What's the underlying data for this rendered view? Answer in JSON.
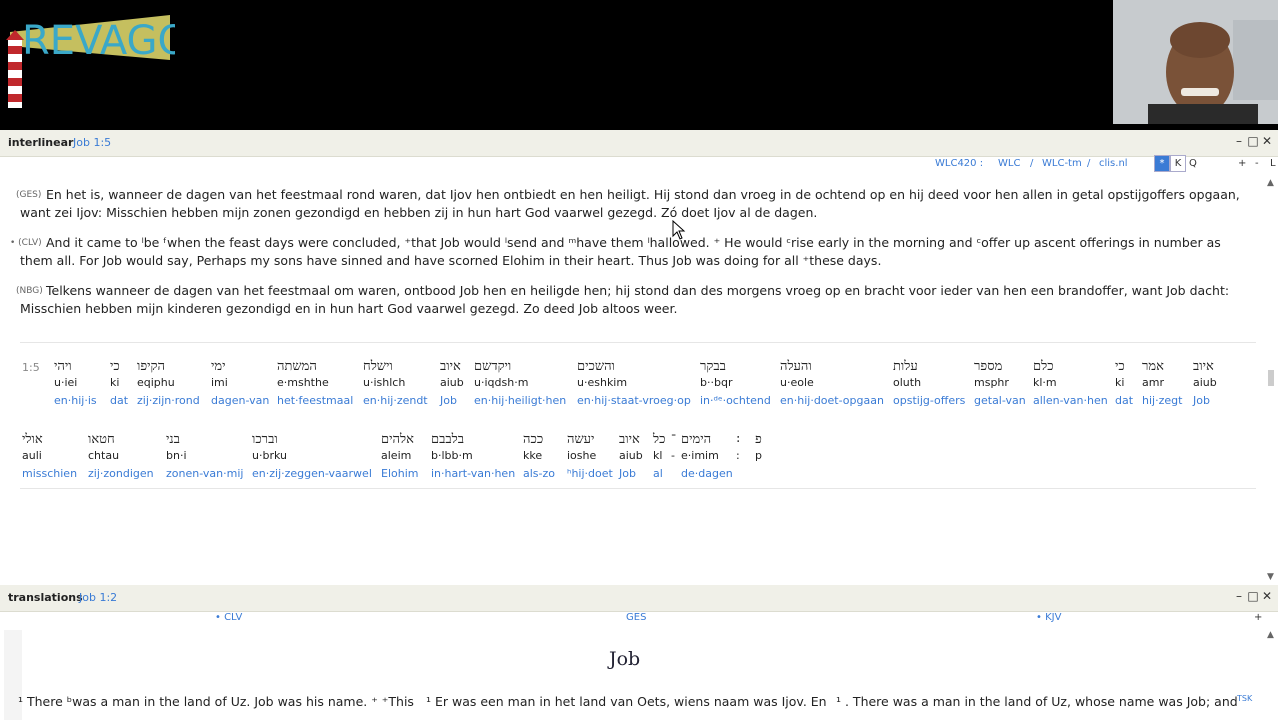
{
  "logo_text": "REVAGO",
  "interlinear": {
    "title": "interlinear",
    "ref": "Job 1:5",
    "toolbar": {
      "items": [
        "WLC420 :",
        "WLC",
        "/",
        "WLC-tm",
        "/",
        "clis.nl"
      ],
      "boxes": [
        "*",
        "K"
      ],
      "q": "Q",
      "plus": "+",
      "minus": "-",
      "extra": "L"
    },
    "verses": [
      {
        "tag": "(GES)",
        "text": "En het is, wanneer de dagen van het feestmaal rond waren, dat Ijov hen ontbiedt en hen heiligt. Hij stond dan vroeg in de ochtend op en hij deed voor hen allen in getal opstijgoffers opgaan, want zei Ijov: Misschien hebben mijn zonen gezondigd en hebben zij in hun hart God vaarwel gezegd. Zó doet Ijov al de dagen."
      },
      {
        "tag": "• (CLV)",
        "text": "And it came to ˡbe ᶠwhen the feast days were concluded, ⁺that Job would ˡsend and ᵐhave them ˡhallowed. ⁺ He would ᶜrise early in the morning and ᶜoffer up ascent offerings in number as them all. For Job would say, Perhaps my sons have sinned and have scorned Elohim in their heart. Thus Job was doing for all ⁺these days."
      },
      {
        "tag": "(NBG)",
        "text": "Telkens wanneer de dagen van het feestmaal om waren, ontbood Job hen en heiligde hen; hij stond dan des morgens vroeg op en bracht voor ieder van hen een brandoffer, want Job dacht: Misschien hebben mijn kinderen gezondigd en in hun hart God vaarwel gezegd. Zo deed Job altoos weer."
      }
    ],
    "verse_num": "1:5",
    "row1": [
      {
        "heb": "ויהי",
        "tr": "u·iei",
        "gl": "en·hij·is"
      },
      {
        "heb": "כי",
        "tr": "ki",
        "gl": "dat"
      },
      {
        "heb": "הקיפו",
        "tr": "eqiphu",
        "gl": "zij·zijn·rond"
      },
      {
        "heb": "ימי",
        "tr": "imi",
        "gl": "dagen-van"
      },
      {
        "heb": "המשתה",
        "tr": "e·mshthe",
        "gl": "het·feestmaal"
      },
      {
        "heb": "וישלח",
        "tr": "u·ishlch",
        "gl": "en·hij·zendt"
      },
      {
        "heb": "איוב",
        "tr": "aiub",
        "gl": "Job"
      },
      {
        "heb": "ויקדשם",
        "tr": "u·iqdsh·m",
        "gl": "en·hij·heiligt·hen"
      },
      {
        "heb": "והשכים",
        "tr": "u·eshkim",
        "gl": "en·hij·staat-vroeg·op"
      },
      {
        "heb": "בבקר",
        "tr": "b··bqr",
        "gl": "in·ᵈᵉ·ochtend"
      },
      {
        "heb": "והעלה",
        "tr": "u·eole",
        "gl": "en·hij·doet-opgaan"
      },
      {
        "heb": "עלות",
        "tr": "oluth",
        "gl": "opstijg-offers"
      },
      {
        "heb": "מספר",
        "tr": "msphr",
        "gl": "getal-van"
      },
      {
        "heb": "כלם",
        "tr": "kl·m",
        "gl": "allen-van·hen"
      },
      {
        "heb": "כי",
        "tr": "ki",
        "gl": "dat"
      },
      {
        "heb": "אמר",
        "tr": "amr",
        "gl": "hij·zegt"
      },
      {
        "heb": "איוב",
        "tr": "aiub",
        "gl": "Job"
      }
    ],
    "row2": [
      {
        "heb": "אולי",
        "tr": "auli",
        "gl": "misschien"
      },
      {
        "heb": "חטאו",
        "tr": "chtau",
        "gl": "zij·zondigen"
      },
      {
        "heb": "בני",
        "tr": "bn·i",
        "gl": "zonen-van·mij"
      },
      {
        "heb": "וברכו",
        "tr": "u·brku",
        "gl": "en·zij·zeggen-vaarwel"
      },
      {
        "heb": "אלהים",
        "tr": "aleim",
        "gl": "Elohim"
      },
      {
        "heb": "בלבבם",
        "tr": "b·lbb·m",
        "gl": "in·hart-van·hen"
      },
      {
        "heb": "ככה",
        "tr": "kke",
        "gl": "als-zo"
      },
      {
        "heb": "יעשה",
        "tr": "ioshe",
        "gl": "ʰhij·doet"
      },
      {
        "heb": "איוב",
        "tr": "aiub",
        "gl": "Job"
      },
      {
        "heb": "כל",
        "tr": "kl",
        "gl": "al"
      },
      {
        "heb": "־",
        "tr": "-",
        "gl": ""
      },
      {
        "heb": "הימים",
        "tr": "e·imim",
        "gl": "de·dagen"
      },
      {
        "heb": ":",
        "tr": ":",
        "gl": ""
      },
      {
        "heb": "פ",
        "tr": "p",
        "gl": ""
      }
    ]
  },
  "translations": {
    "title": "translations",
    "ref": "Job 1:2",
    "cols": [
      "• CLV",
      "GES",
      "• KJV"
    ],
    "plus": "+",
    "book": "Job",
    "texts": [
      "¹ There ᵇwas a man in the land of Uz. Job was his name. ⁺ ⁺This",
      "¹ Er was een man in het land van Oets, wiens naam was Ijov. En",
      "¹ . There was a man in the land of Uz, whose name was Job; and"
    ],
    "tsk": "TSK"
  },
  "window_controls": {
    "min": "–",
    "max": "□",
    "close": "✕"
  }
}
